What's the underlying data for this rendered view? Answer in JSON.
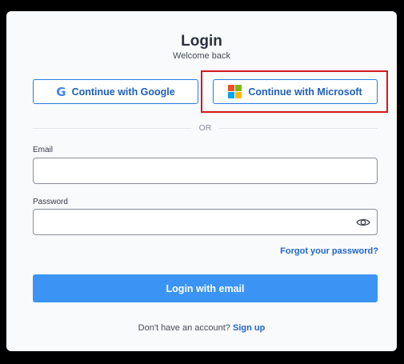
{
  "header": {
    "title": "Login",
    "subtitle": "Welcome back"
  },
  "oauth": {
    "google_label": "Continue with Google",
    "google_icon": "google-g-icon",
    "microsoft_label": "Continue with Microsoft",
    "microsoft_icon": "microsoft-logo-icon",
    "google_color": "#4285F4",
    "microsoft_colors": [
      "#F25022",
      "#7FBA00",
      "#00A4EF",
      "#FFB900"
    ]
  },
  "divider": {
    "text": "OR"
  },
  "form": {
    "email_label": "Email",
    "email_value": "",
    "password_label": "Password",
    "password_value": "",
    "password_toggle_icon": "eye-icon",
    "forgot_label": "Forgot your password?",
    "submit_label": "Login with email"
  },
  "footer": {
    "prompt": "Don't have an account?",
    "signup_label": "Sign up"
  },
  "colors": {
    "accent": "#3b94f3",
    "link": "#1f66c9",
    "highlight": "#d11a1a"
  }
}
